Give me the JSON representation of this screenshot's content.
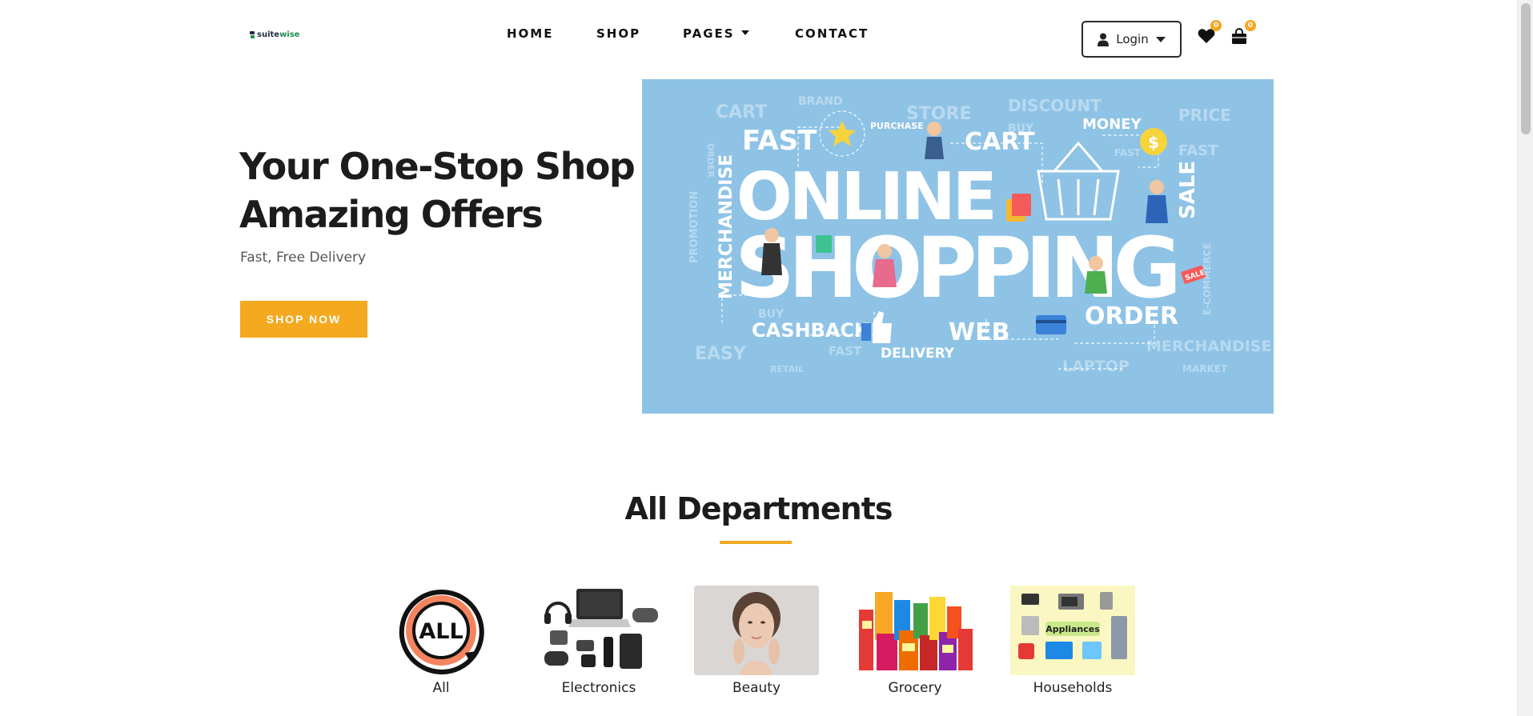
{
  "brand": {
    "logo_part1": "suite",
    "logo_part2": "wise"
  },
  "nav": {
    "items": [
      {
        "label": "HOME"
      },
      {
        "label": "SHOP"
      },
      {
        "label": "PAGES"
      },
      {
        "label": "CONTACT"
      }
    ]
  },
  "header": {
    "login_label": "Login",
    "wishlist_count": "0",
    "cart_count": "0"
  },
  "hero": {
    "title_line1": "Your One-Stop Shop",
    "title_line2": "Amazing Offers",
    "subtitle": "Fast, Free Delivery",
    "cta_label": "SHOP NOW"
  },
  "banner": {
    "headline1": "ONLINE",
    "headline2": "SHOPPING",
    "words": {
      "cart": "CART",
      "brand": "BRAND",
      "store": "STORE",
      "discount": "DISCOUNT",
      "price": "PRICE",
      "fast": "FAST",
      "purchase": "PURCHASE",
      "cart2": "CART",
      "money": "MONEY",
      "buy": "BUY",
      "fast2": "FAST",
      "fast3": "FAST",
      "sale": "SALE",
      "merchandise": "MERCHANDISE",
      "promotion": "PROMOTION",
      "order_small": "ORDER",
      "ecommerce": "E-COMMERCE",
      "cashback": "CASHBACK",
      "web": "WEB",
      "order": "ORDER",
      "buy2": "BUY",
      "easy": "EASY",
      "fast4": "FAST",
      "delivery": "DELIVERY",
      "merchandise2": "MERCHANDISE",
      "retail": "RETAIL",
      "laptop": "LAPTOP",
      "market": "MARKET",
      "sale_tag": "SALE"
    }
  },
  "departments": {
    "title": "All Departments",
    "items": [
      {
        "label": "All",
        "badge_text": "ALL"
      },
      {
        "label": "Electronics"
      },
      {
        "label": "Beauty"
      },
      {
        "label": "Grocery"
      },
      {
        "label": "Households",
        "badge_text": "Appliances"
      }
    ]
  },
  "colors": {
    "accent": "#f4a91f",
    "banner_bg": "#8ec3e6",
    "brand_dark": "#1f2d3d",
    "brand_green": "#1e8f4e"
  }
}
